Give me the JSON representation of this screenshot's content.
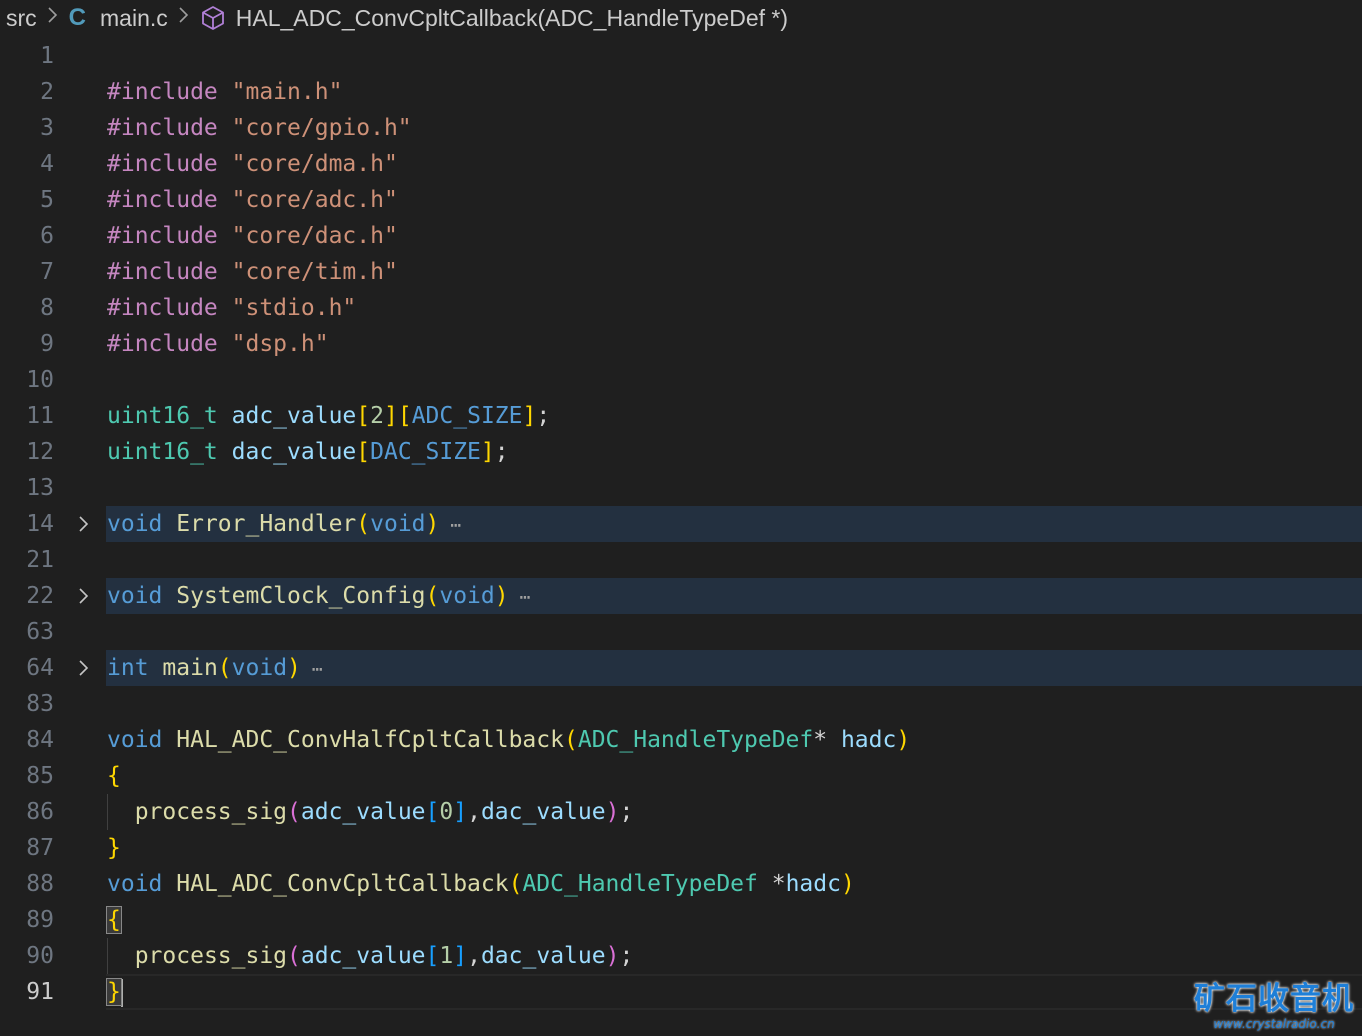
{
  "breadcrumb": {
    "folder": "src",
    "file_icon": "C",
    "file": "main.c",
    "symbol": "HAL_ADC_ConvCpltCallback(ADC_HandleTypeDef *)"
  },
  "icons": {
    "chevron": "chevron-right-icon",
    "symbol": "cube-icon",
    "fold": "fold-chevron-icon",
    "ellipsis": "ellipsis-icon"
  },
  "colors": {
    "background": "#1f1f1f",
    "keyword": "#c586c0",
    "string": "#ce9178",
    "type": "#4ec9b0",
    "variable": "#9cdcfe",
    "function": "#dcdcaa",
    "storage": "#569cd6",
    "bracket_gold": "#ffd700",
    "bracket_orchid": "#da70d6",
    "bracket_blue": "#179fff",
    "folded_line": "#233040",
    "watermark": "#1e7fd8"
  },
  "ellipsis": "⋯",
  "lines": [
    {
      "n": "1",
      "tokens": []
    },
    {
      "n": "2",
      "tokens": [
        [
          "kw",
          "#include"
        ],
        [
          "pl",
          " "
        ],
        [
          "str",
          "\"main.h\""
        ]
      ]
    },
    {
      "n": "3",
      "tokens": [
        [
          "kw",
          "#include"
        ],
        [
          "pl",
          " "
        ],
        [
          "str",
          "\"core/gpio.h\""
        ]
      ]
    },
    {
      "n": "4",
      "tokens": [
        [
          "kw",
          "#include"
        ],
        [
          "pl",
          " "
        ],
        [
          "str",
          "\"core/dma.h\""
        ]
      ]
    },
    {
      "n": "5",
      "tokens": [
        [
          "kw",
          "#include"
        ],
        [
          "pl",
          " "
        ],
        [
          "str",
          "\"core/adc.h\""
        ]
      ]
    },
    {
      "n": "6",
      "tokens": [
        [
          "kw",
          "#include"
        ],
        [
          "pl",
          " "
        ],
        [
          "str",
          "\"core/dac.h\""
        ]
      ]
    },
    {
      "n": "7",
      "tokens": [
        [
          "kw",
          "#include"
        ],
        [
          "pl",
          " "
        ],
        [
          "str",
          "\"core/tim.h\""
        ]
      ]
    },
    {
      "n": "8",
      "tokens": [
        [
          "kw",
          "#include"
        ],
        [
          "pl",
          " "
        ],
        [
          "str",
          "\"stdio.h\""
        ]
      ]
    },
    {
      "n": "9",
      "tokens": [
        [
          "kw",
          "#include"
        ],
        [
          "pl",
          " "
        ],
        [
          "str",
          "\"dsp.h\""
        ]
      ]
    },
    {
      "n": "10",
      "tokens": []
    },
    {
      "n": "11",
      "tokens": [
        [
          "type",
          "uint16_t"
        ],
        [
          "pl",
          " "
        ],
        [
          "var",
          "adc_value"
        ],
        [
          "b1",
          "["
        ],
        [
          "num",
          "2"
        ],
        [
          "b1",
          "]"
        ],
        [
          "b1",
          "["
        ],
        [
          "key",
          "ADC_SIZE"
        ],
        [
          "b1",
          "]"
        ],
        [
          "pl",
          ";"
        ]
      ]
    },
    {
      "n": "12",
      "tokens": [
        [
          "type",
          "uint16_t"
        ],
        [
          "pl",
          " "
        ],
        [
          "var",
          "dac_value"
        ],
        [
          "b1",
          "["
        ],
        [
          "key",
          "DAC_SIZE"
        ],
        [
          "b1",
          "]"
        ],
        [
          "pl",
          ";"
        ]
      ]
    },
    {
      "n": "13",
      "tokens": []
    },
    {
      "n": "14",
      "folded": true,
      "tokens": [
        [
          "key",
          "void"
        ],
        [
          "pl",
          " "
        ],
        [
          "func",
          "Error_Handler"
        ],
        [
          "b1",
          "("
        ],
        [
          "key",
          "void"
        ],
        [
          "b1",
          ")"
        ]
      ]
    },
    {
      "n": "21",
      "tokens": []
    },
    {
      "n": "22",
      "folded": true,
      "tokens": [
        [
          "key",
          "void"
        ],
        [
          "pl",
          " "
        ],
        [
          "func",
          "SystemClock_Config"
        ],
        [
          "b1",
          "("
        ],
        [
          "key",
          "void"
        ],
        [
          "b1",
          ")"
        ]
      ]
    },
    {
      "n": "63",
      "tokens": []
    },
    {
      "n": "64",
      "folded": true,
      "tokens": [
        [
          "key",
          "int"
        ],
        [
          "pl",
          " "
        ],
        [
          "func",
          "main"
        ],
        [
          "b1",
          "("
        ],
        [
          "key",
          "void"
        ],
        [
          "b1",
          ")"
        ]
      ]
    },
    {
      "n": "83",
      "tokens": []
    },
    {
      "n": "84",
      "tokens": [
        [
          "key",
          "void"
        ],
        [
          "pl",
          " "
        ],
        [
          "func",
          "HAL_ADC_ConvHalfCpltCallback"
        ],
        [
          "b1",
          "("
        ],
        [
          "type",
          "ADC_HandleTypeDef"
        ],
        [
          "pl",
          "* "
        ],
        [
          "var",
          "hadc"
        ],
        [
          "b1",
          ")"
        ]
      ]
    },
    {
      "n": "85",
      "tokens": [
        [
          "b1",
          "{"
        ]
      ]
    },
    {
      "n": "86",
      "tokens": [
        [
          "pl",
          "  "
        ],
        [
          "func",
          "process_sig"
        ],
        [
          "b2",
          "("
        ],
        [
          "var",
          "adc_value"
        ],
        [
          "b3",
          "["
        ],
        [
          "num",
          "0"
        ],
        [
          "b3",
          "]"
        ],
        [
          "pl",
          ","
        ],
        [
          "var",
          "dac_value"
        ],
        [
          "b2",
          ")"
        ],
        [
          "pl",
          ";"
        ]
      ]
    },
    {
      "n": "87",
      "tokens": [
        [
          "b1",
          "}"
        ]
      ]
    },
    {
      "n": "88",
      "tokens": [
        [
          "key",
          "void"
        ],
        [
          "pl",
          " "
        ],
        [
          "func",
          "HAL_ADC_ConvCpltCallback"
        ],
        [
          "b1",
          "("
        ],
        [
          "type",
          "ADC_HandleTypeDef"
        ],
        [
          "pl",
          " *"
        ],
        [
          "var",
          "hadc"
        ],
        [
          "b1",
          ")"
        ]
      ]
    },
    {
      "n": "89",
      "tokens": [
        [
          "b1m",
          "{"
        ]
      ]
    },
    {
      "n": "90",
      "tokens": [
        [
          "pl",
          "  "
        ],
        [
          "func",
          "process_sig"
        ],
        [
          "b2",
          "("
        ],
        [
          "var",
          "adc_value"
        ],
        [
          "b3",
          "["
        ],
        [
          "num",
          "1"
        ],
        [
          "b3",
          "]"
        ],
        [
          "pl",
          ","
        ],
        [
          "var",
          "dac_value"
        ],
        [
          "b2",
          ")"
        ],
        [
          "pl",
          ";"
        ]
      ]
    },
    {
      "n": "91",
      "active": true,
      "tokens": [
        [
          "b1m",
          "}"
        ]
      ]
    }
  ],
  "watermark": {
    "main": "矿石收音机",
    "sub": "www.crystalradio.cn"
  }
}
